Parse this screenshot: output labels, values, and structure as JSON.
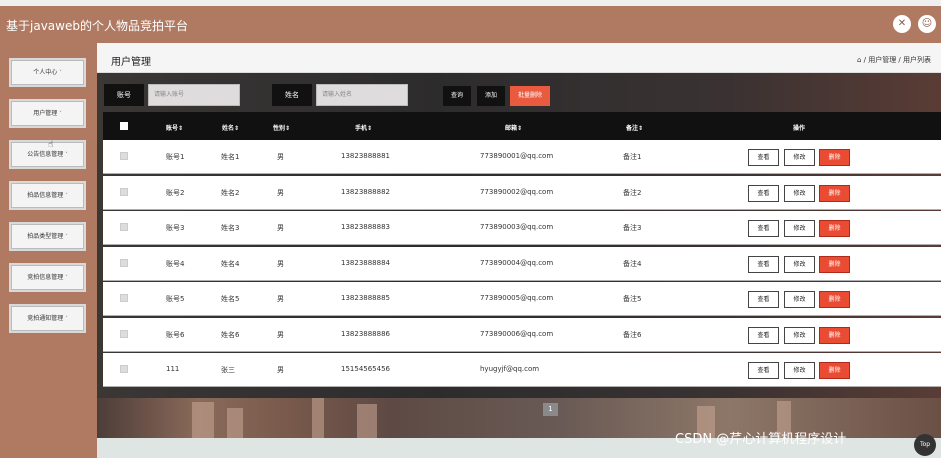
{
  "app": {
    "title": "基于javaweb的个人物品竞拍平台",
    "icons": {
      "fullscreen": "✕",
      "user": "☺"
    }
  },
  "sidebar": {
    "items": [
      {
        "label": "个人中心"
      },
      {
        "label": "用户管理"
      },
      {
        "label": "公告信息管理"
      },
      {
        "label": "拍品信息管理"
      },
      {
        "label": "拍品类型管理"
      },
      {
        "label": "竞拍信息管理"
      },
      {
        "label": "竞拍通知管理"
      }
    ],
    "caret": "˅"
  },
  "page": {
    "title": "用户管理",
    "breadcrumb": "⌂ / 用户管理 / 用户列表"
  },
  "search": {
    "account_label": "账号",
    "account_placeholder": "请输入账号",
    "name_label": "姓名",
    "name_placeholder": "请输入姓名",
    "query_button": "查询",
    "add_button": "添加",
    "batch_delete_button": "批量删除"
  },
  "table": {
    "headers": {
      "account": "账号⇕",
      "name": "姓名⇕",
      "gender": "性别⇕",
      "phone": "手机⇕",
      "email": "邮箱⇕",
      "note": "备注⇕",
      "actions": "操作"
    },
    "action_labels": {
      "view": "查看",
      "edit": "修改",
      "delete": "删除"
    },
    "rows": [
      {
        "account": "账号1",
        "name": "姓名1",
        "gender": "男",
        "phone": "13823888881",
        "email": "773890001@qq.com",
        "note": "备注1"
      },
      {
        "account": "账号2",
        "name": "姓名2",
        "gender": "男",
        "phone": "13823888882",
        "email": "773890002@qq.com",
        "note": "备注2"
      },
      {
        "account": "账号3",
        "name": "姓名3",
        "gender": "男",
        "phone": "13823888883",
        "email": "773890003@qq.com",
        "note": "备注3"
      },
      {
        "account": "账号4",
        "name": "姓名4",
        "gender": "男",
        "phone": "13823888884",
        "email": "773890004@qq.com",
        "note": "备注4"
      },
      {
        "account": "账号5",
        "name": "姓名5",
        "gender": "男",
        "phone": "13823888885",
        "email": "773890005@qq.com",
        "note": "备注5"
      },
      {
        "account": "账号6",
        "name": "姓名6",
        "gender": "男",
        "phone": "13823888886",
        "email": "773890006@qq.com",
        "note": "备注6"
      },
      {
        "account": "111",
        "name": "张三",
        "gender": "男",
        "phone": "15154565456",
        "email": "hyugyjf@qq.com",
        "note": ""
      }
    ]
  },
  "pagination": {
    "current_page": "1"
  },
  "watermark": "CSDN @芹心计算机程序设计",
  "back_to_top": "Top"
}
